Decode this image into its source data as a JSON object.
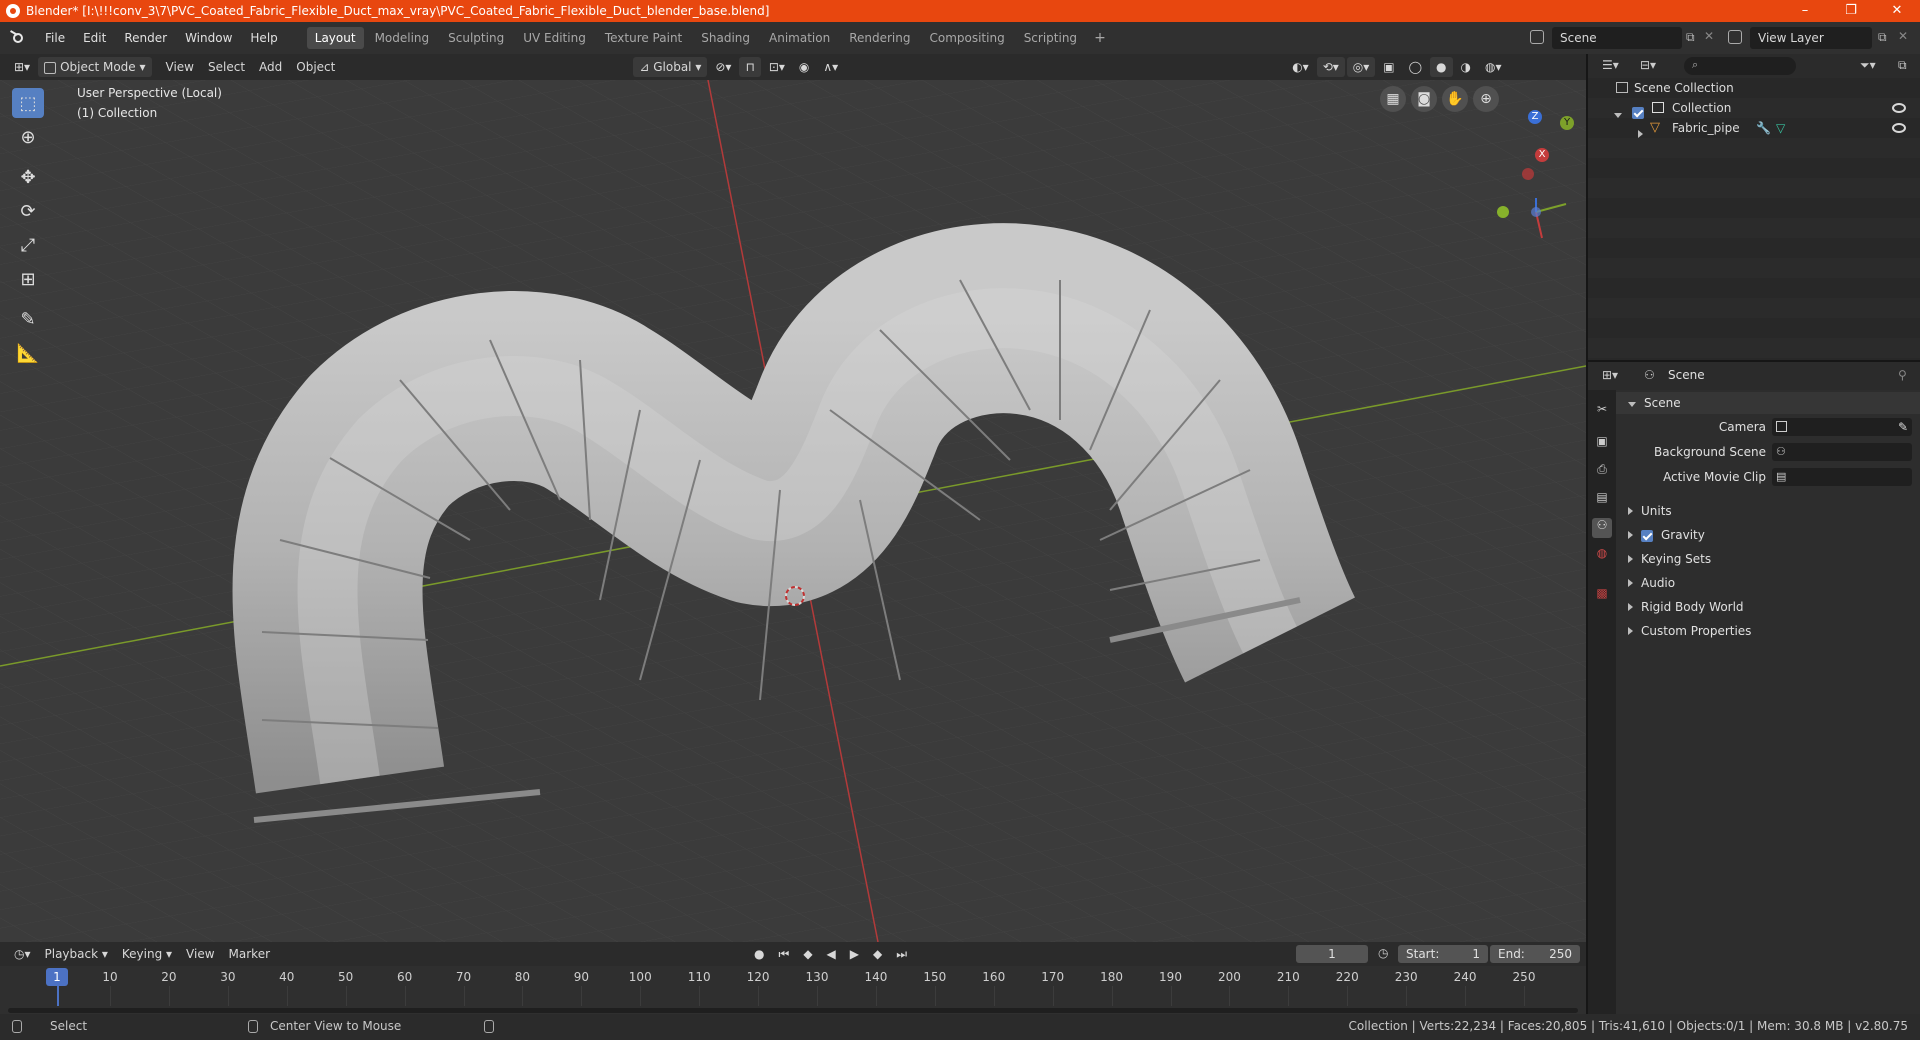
{
  "window": {
    "title": "Blender* [I:\\!!!conv_3\\7\\PVC_Coated_Fabric_Flexible_Duct_max_vray\\PVC_Coated_Fabric_Flexible_Duct_blender_base.blend]",
    "minimize": "–",
    "maximize": "❐",
    "close": "✕"
  },
  "menu": [
    "File",
    "Edit",
    "Render",
    "Window",
    "Help"
  ],
  "workspaces": [
    "Layout",
    "Modeling",
    "Sculpting",
    "UV Editing",
    "Texture Paint",
    "Shading",
    "Animation",
    "Rendering",
    "Compositing",
    "Scripting"
  ],
  "workspace_active": "Layout",
  "workspace_add": "+",
  "scene_name": "Scene",
  "view_layer": "View Layer",
  "viewport_header": {
    "mode": "Object Mode",
    "menus": [
      "View",
      "Select",
      "Add",
      "Object"
    ],
    "transform_orientation": "Global"
  },
  "viewport": {
    "perspective": "User Perspective (Local)",
    "collection": "(1) Collection",
    "gizmo": {
      "x": "X",
      "y": "Y",
      "z": "Z"
    }
  },
  "timeline": {
    "menus": [
      "Playback",
      "Keying",
      "View",
      "Marker"
    ],
    "current_frame": "1",
    "start_label": "Start:",
    "start": "1",
    "end_label": "End:",
    "end": "250",
    "ticks": [
      "1",
      "10",
      "20",
      "30",
      "40",
      "50",
      "60",
      "70",
      "80",
      "90",
      "100",
      "110",
      "120",
      "130",
      "140",
      "150",
      "160",
      "170",
      "180",
      "190",
      "200",
      "210",
      "220",
      "230",
      "240",
      "250"
    ]
  },
  "status": {
    "select": "Select",
    "center": "Center View to Mouse",
    "stats": "Collection | Verts:22,234 | Faces:20,805 | Tris:41,610 | Objects:0/1 | Mem: 30.8 MB | v2.80.75"
  },
  "outliner": {
    "root": "Scene Collection",
    "collection": "Collection",
    "object": "Fabric_pipe"
  },
  "properties": {
    "context": "Scene",
    "panel": "Scene",
    "camera_label": "Camera",
    "bg_scene_label": "Background Scene",
    "movie_clip_label": "Active Movie Clip",
    "subpanels": [
      "Units",
      "Gravity",
      "Keying Sets",
      "Audio",
      "Rigid Body World",
      "Custom Properties"
    ]
  }
}
